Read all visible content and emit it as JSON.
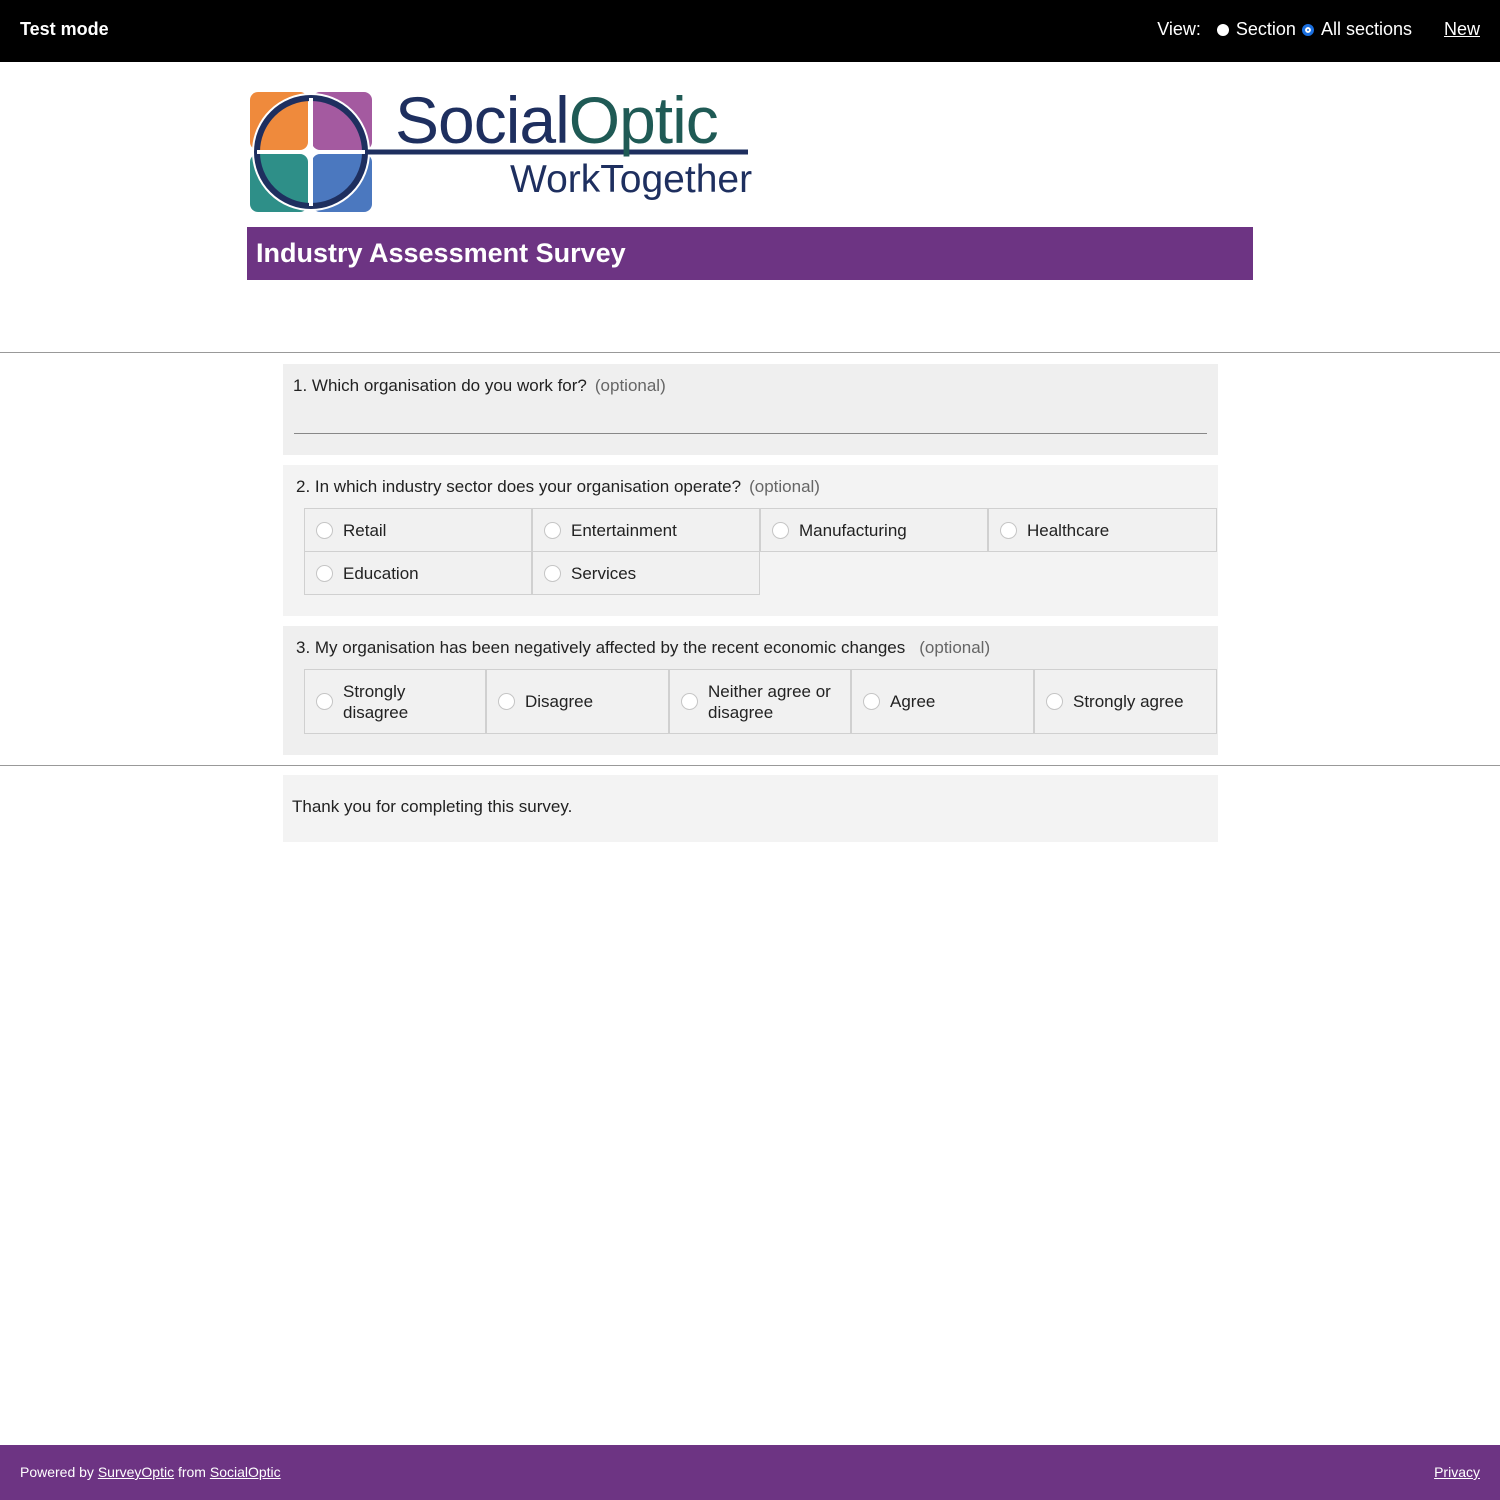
{
  "topbar": {
    "mode_label": "Test mode",
    "view_label": "View:",
    "view_options": [
      "Section",
      "All sections"
    ],
    "view_selected": "All sections",
    "new_link": "New"
  },
  "logo": {
    "brand_part1": "Social",
    "brand_part2": "Optic",
    "subtitle": "WorkTogether",
    "colors": {
      "orange": "#ef8a3c",
      "purple": "#a45aa0",
      "teal": "#2e8f88",
      "blue": "#4b78bf",
      "navy": "#1e2f5f",
      "dark_teal": "#1f5a55"
    }
  },
  "survey": {
    "title": "Industry Assessment Survey",
    "accent_color": "#6d3483",
    "optional_text": "(optional)",
    "q1": {
      "text": "1. Which organisation do you work for?",
      "value": ""
    },
    "q2": {
      "text": "2. In which industry sector does your organisation operate?",
      "options": [
        "Retail",
        "Entertainment",
        "Manufacturing",
        "Healthcare",
        "Education",
        "Services"
      ]
    },
    "q3": {
      "text": "3. My organisation has been negatively affected by the recent economic changes",
      "options": [
        "Strongly disagree",
        "Disagree",
        "Neither agree or disagree",
        "Agree",
        "Strongly agree"
      ]
    },
    "closing": "Thank you for completing this survey."
  },
  "footer": {
    "powered_by": "Powered by",
    "surveyoptic_link": "SurveyOptic",
    "from": "from",
    "socialoptic_link": "SocialOptic",
    "privacy_link": "Privacy"
  }
}
